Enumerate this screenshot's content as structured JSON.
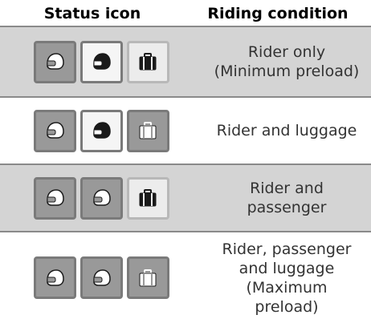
{
  "header": {
    "status_icon": "Status icon",
    "riding_condition": "Riding condition"
  },
  "rows": [
    {
      "condition_lines": [
        "Rider only",
        "(Minimum preload)"
      ],
      "icons": [
        {
          "name": "rider-helmet-icon",
          "state": "on",
          "glyph": "white"
        },
        {
          "name": "passenger-helmet-icon",
          "state": "sel",
          "glyph": "black"
        },
        {
          "name": "luggage-icon",
          "state": "off",
          "glyph": "black"
        }
      ]
    },
    {
      "condition_lines": [
        "Rider and luggage"
      ],
      "icons": [
        {
          "name": "rider-helmet-icon",
          "state": "on",
          "glyph": "white"
        },
        {
          "name": "passenger-helmet-icon",
          "state": "sel",
          "glyph": "black"
        },
        {
          "name": "luggage-icon",
          "state": "on",
          "glyph": "white"
        }
      ]
    },
    {
      "condition_lines": [
        "Rider and",
        "passenger"
      ],
      "icons": [
        {
          "name": "rider-helmet-icon",
          "state": "on",
          "glyph": "white"
        },
        {
          "name": "passenger-helmet-icon",
          "state": "on",
          "glyph": "white"
        },
        {
          "name": "luggage-icon",
          "state": "off",
          "glyph": "black"
        }
      ]
    },
    {
      "condition_lines": [
        "Rider, passenger",
        "and luggage",
        "(Maximum",
        "preload)"
      ],
      "icons": [
        {
          "name": "rider-helmet-icon",
          "state": "on",
          "glyph": "white"
        },
        {
          "name": "passenger-helmet-icon",
          "state": "on",
          "glyph": "white"
        },
        {
          "name": "luggage-icon",
          "state": "on",
          "glyph": "white"
        }
      ]
    }
  ]
}
